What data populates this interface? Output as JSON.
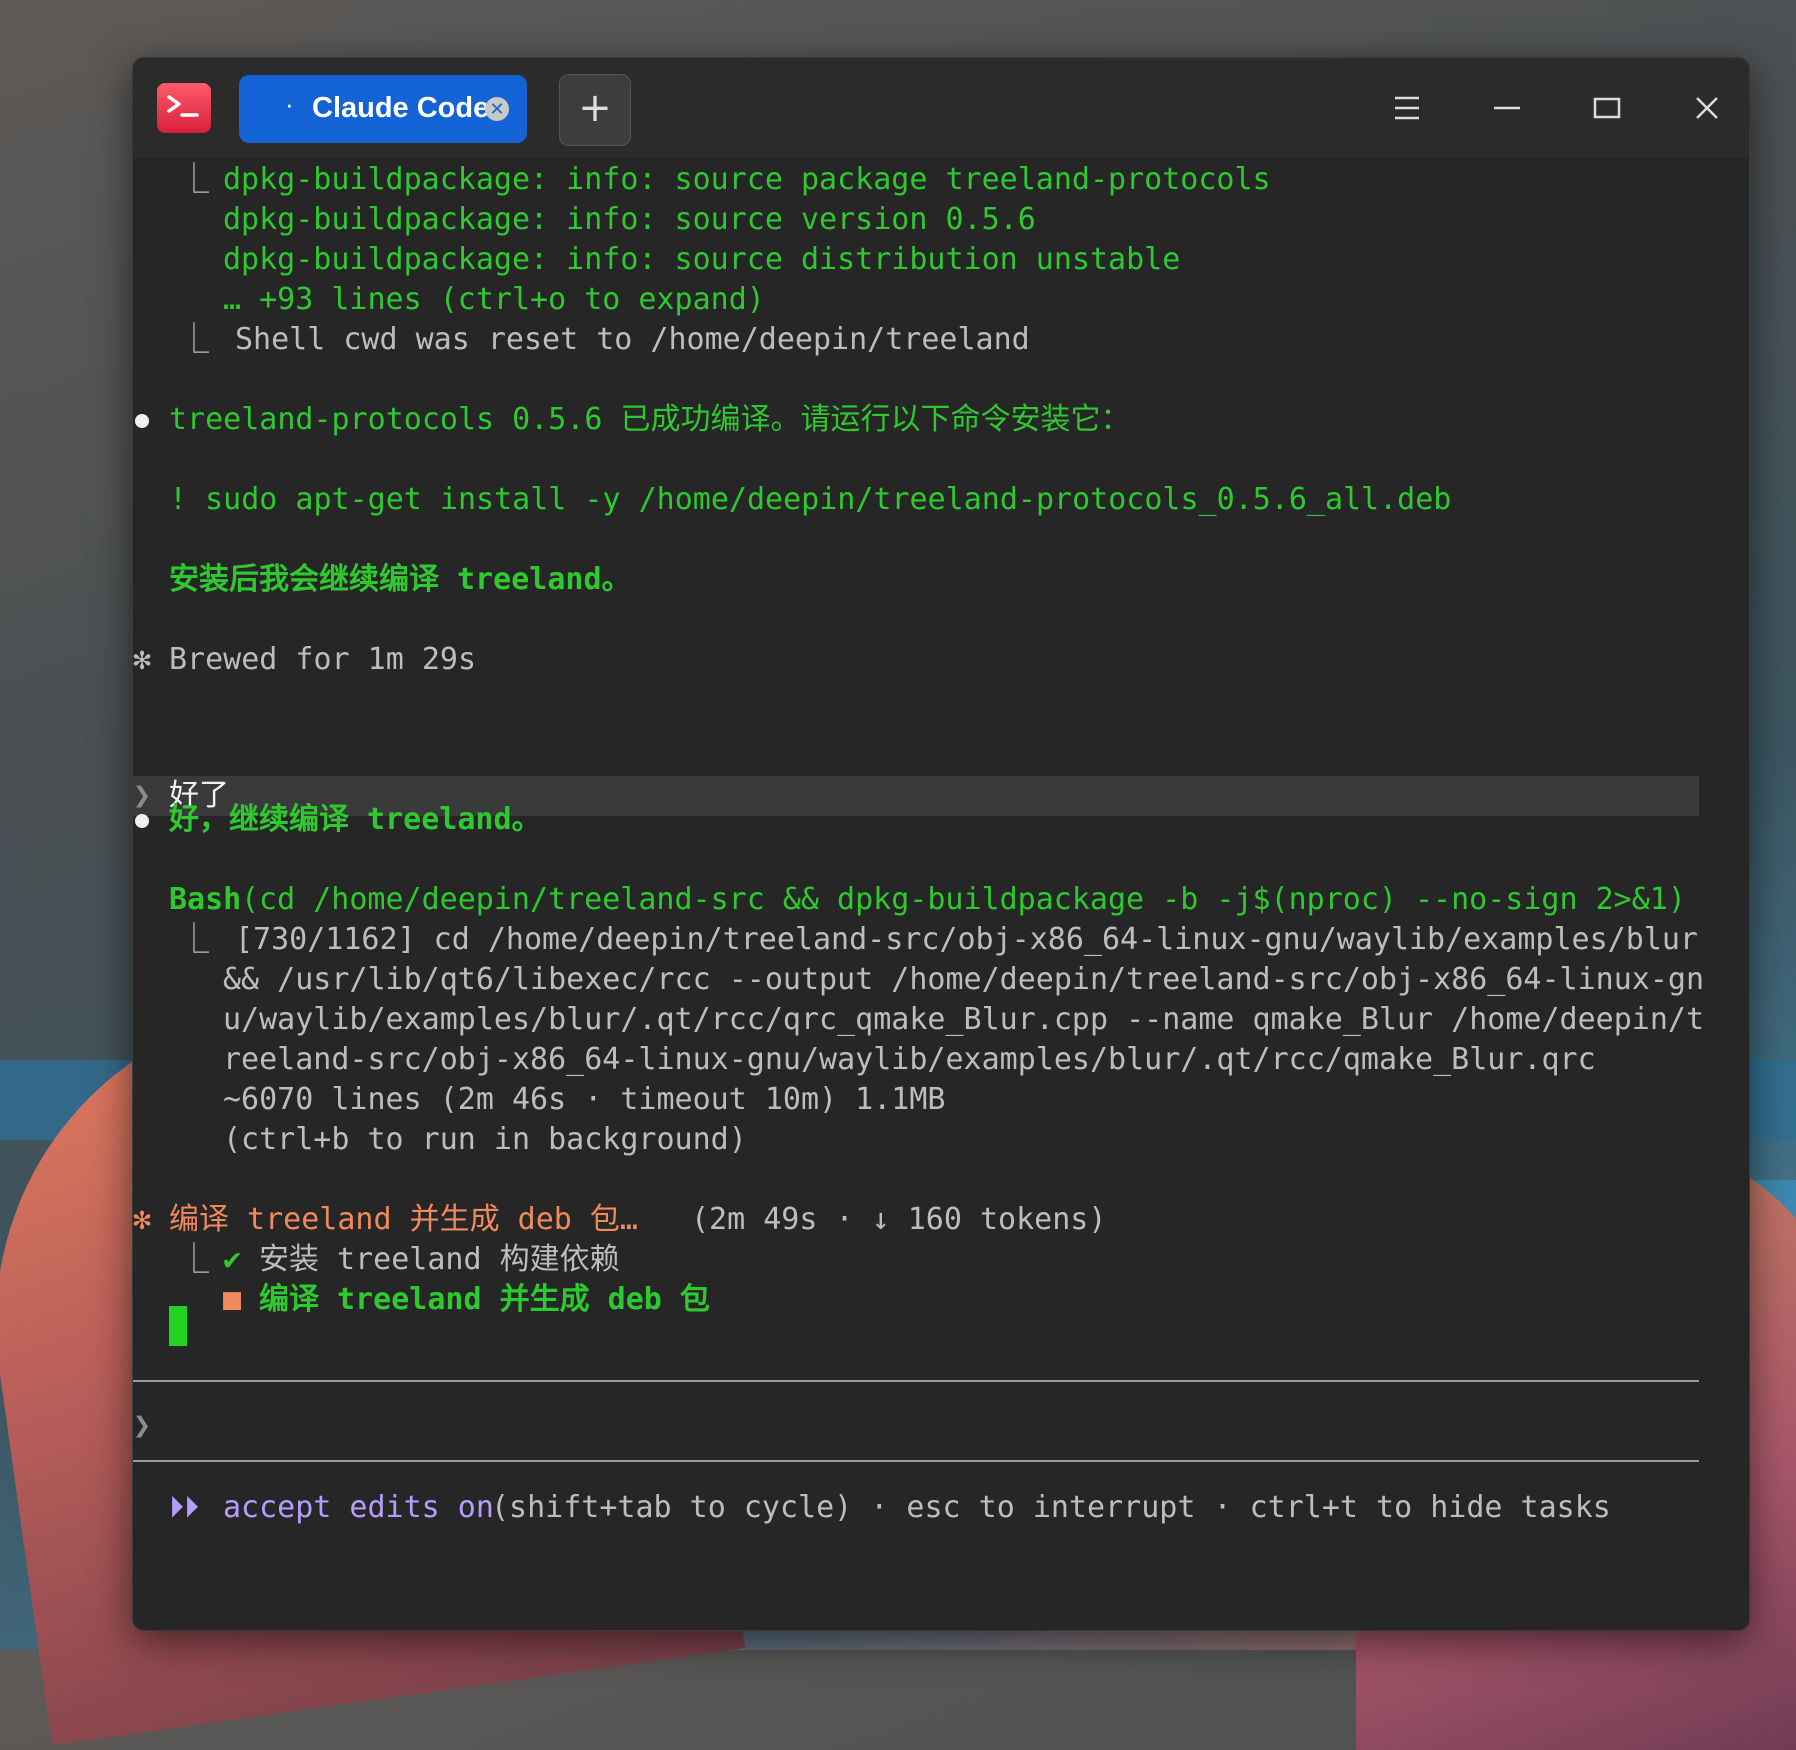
{
  "window": {
    "tab_label": "Claude Code",
    "tab_dot": "·",
    "new_tab_symbol": "+",
    "icons": [
      "terminal-app-icon",
      "tab-close-icon",
      "menu-icon",
      "minimize-icon",
      "maximize-icon",
      "close-icon"
    ]
  },
  "output": {
    "l1_prefix": "⎿",
    "l1": "dpkg-buildpackage: info: source package treeland-protocols",
    "l2": "dpkg-buildpackage: info: source version 0.5.6",
    "l3": "dpkg-buildpackage: info: source distribution unstable",
    "l4": "… +93 lines (ctrl+o to expand)",
    "l5_prefix": "⎿",
    "l5": "Shell cwd was reset to /home/deepin/treeland",
    "msg1": "treeland-protocols 0.5.6 已成功编译。请运行以下命令安装它：",
    "cmd1": "! sudo apt-get install -y /home/deepin/treeland-protocols_0.5.6_all.deb",
    "msg2": "安装后我会继续编译 treeland。",
    "brewed_star": "✻",
    "brewed": "Brewed for 1m 29s",
    "user_prompt": "❯",
    "user_msg": "好了",
    "msg3": "好，继续编译 treeland。",
    "bash_tool": "Bash",
    "bash_cmd": "(cd /home/deepin/treeland-src && dpkg-buildpackage -b -j$(nproc) --no-sign 2>&1)",
    "bash_out_prefix": "⎿",
    "bash_out1": "[730/1162] cd /home/deepin/treeland-src/obj-x86_64-linux-gnu/waylib/examples/blur",
    "bash_out2": "&& /usr/lib/qt6/libexec/rcc --output /home/deepin/treeland-src/obj-x86_64-linux-gn",
    "bash_out3": "u/waylib/examples/blur/.qt/rcc/qrc_qmake_Blur.cpp --name qmake_Blur /home/deepin/t",
    "bash_out4": "reeland-src/obj-x86_64-linux-gnu/waylib/examples/blur/.qt/rcc/qmake_Blur.qrc",
    "bash_out5": "~6070 lines (2m 46s · timeout 10m) 1.1MB",
    "bash_out6": "(ctrl+b to run in background)",
    "status_star": "✻",
    "status_task": "编译 treeland 并生成 deb 包…",
    "status_meta": "(2m 49s · ↓ 160 tokens)",
    "todo_prefix": "⎿",
    "todo1_mark": "✔",
    "todo1": "安装 treeland 构建依赖",
    "todo2_mark": "■",
    "todo2": "编译 treeland 并生成 deb 包"
  },
  "input": {
    "prompt": "❯",
    "value": ""
  },
  "footer": {
    "arrows": "⏵⏵",
    "mode": "accept edits on",
    "hints": "(shift+tab to cycle) · esc to interrupt · ctrl+t to hide tasks"
  },
  "colors": {
    "terminal_bg": "#262626",
    "green": "#2ec92e",
    "orange": "#f08a5d",
    "purple": "#b79cff",
    "tab_blue": "#1463d6",
    "app_icon_red": "#e0263f"
  }
}
